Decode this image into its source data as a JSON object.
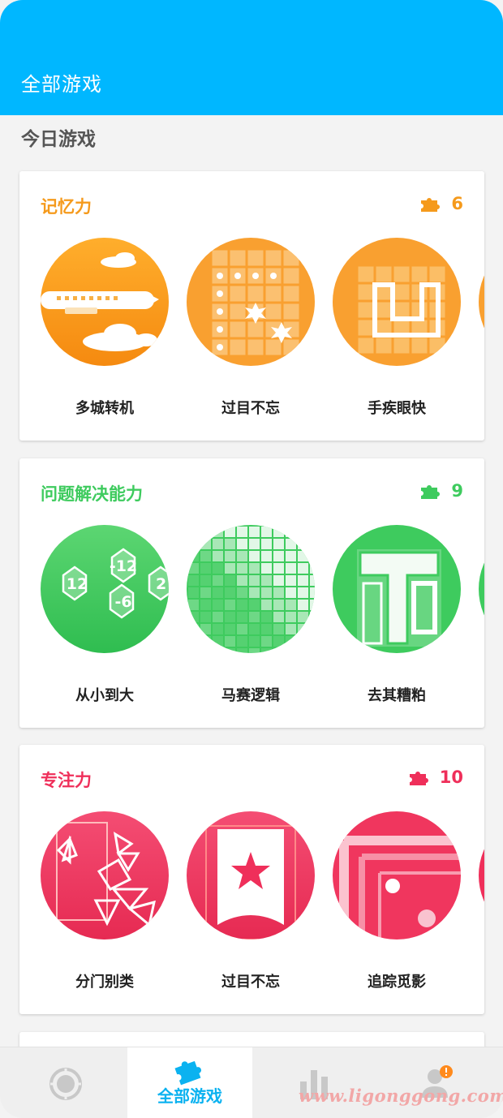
{
  "appbar": {
    "title": "全部游戏",
    "color": "#00b7ff"
  },
  "section": {
    "title": "今日游戏"
  },
  "categories": [
    {
      "title": "记忆力",
      "count": "6",
      "color": "#f59a1c",
      "games": [
        {
          "label": "多城转机",
          "icon": "airplane-icon"
        },
        {
          "label": "过目不忘",
          "icon": "grid-burst-icon"
        },
        {
          "label": "手疾眼快",
          "icon": "maze-grid-icon"
        }
      ]
    },
    {
      "title": "问题解决能力",
      "count": "9",
      "color": "#3ecb5e",
      "games": [
        {
          "label": "从小到大",
          "icon": "hexagon-numbers-icon",
          "numbers": [
            "12",
            "-12",
            "-6",
            "2"
          ]
        },
        {
          "label": "马赛逻辑",
          "icon": "mosaic-grid-icon"
        },
        {
          "label": "去其糟粕",
          "icon": "block-puzzle-icon"
        }
      ]
    },
    {
      "title": "专注力",
      "count": "10",
      "color": "#ef2f5a",
      "games": [
        {
          "label": "分门别类",
          "icon": "tangram-icon"
        },
        {
          "label": "过目不忘",
          "icon": "star-card-icon"
        },
        {
          "label": "追踪觅影",
          "icon": "tracking-board-icon"
        }
      ]
    }
  ],
  "bottom_nav": {
    "items": [
      {
        "icon": "dashboard-icon",
        "label": ""
      },
      {
        "icon": "puzzle-icon",
        "label": "全部游戏",
        "active": true
      },
      {
        "icon": "bar-chart-icon",
        "label": ""
      },
      {
        "icon": "profile-alert-icon",
        "label": ""
      }
    ]
  },
  "watermark": "www.ligonggong.com"
}
